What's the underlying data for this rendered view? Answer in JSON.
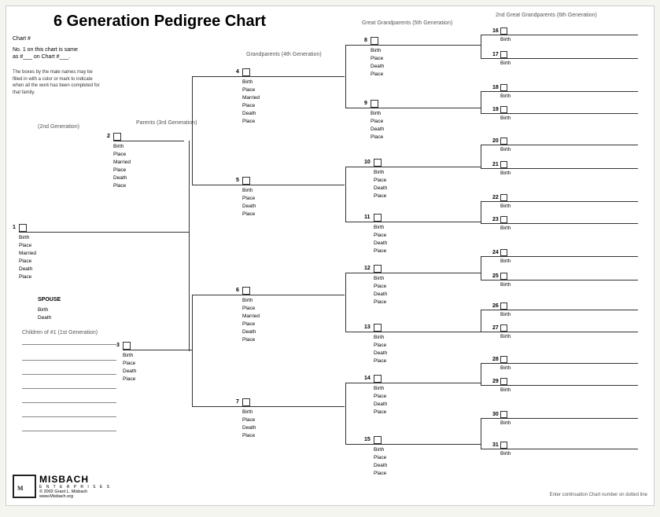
{
  "title": "6 Generation Pedigree Chart",
  "chartNum": "Chart #",
  "note1": "No. 1 on this chart is same",
  "note1b": "as #___ on Chart #___.",
  "note2": "The boxes by the male names may be filled in with a color or mark to indicate when all the work has been completed for that family.",
  "genLabels": {
    "gen2": "(2nd Generation)",
    "gen3": "Parents (3rd Generation)",
    "gen4": "Grandparents (4th Generation)",
    "gen5": "Great Grandparents (5th Generation)",
    "gen6": "2nd Great Grandparents (6th Generation)"
  },
  "fields": [
    "Birth",
    "Place",
    "Married",
    "Place",
    "Death",
    "Place"
  ],
  "fieldsShort": [
    "Birth",
    "Place",
    "Death",
    "Place"
  ],
  "fieldsBirth": [
    "Birth"
  ],
  "spouse": {
    "label": "SPOUSE",
    "fields": [
      "Birth",
      "Death"
    ]
  },
  "children": "Children of #1 (1st Generation)",
  "contLabel": "Enter continuation Chart number on dotted line",
  "logoText": "MISBACH",
  "logoSub": "E N T E R P R I S E S",
  "logoCopy": "© 2002 Grant L. Misbach",
  "logoUrl": "www.Misbach.org",
  "persons": [
    {
      "num": "1",
      "fields": [
        "Birth",
        "Place",
        "Married",
        "Place",
        "Death",
        "Place"
      ]
    },
    {
      "num": "2",
      "fields": [
        "Birth",
        "Place",
        "Married",
        "Place",
        "Death",
        "Place"
      ]
    },
    {
      "num": "3",
      "fields": [
        "Birth",
        "Place",
        "Death",
        "Place"
      ]
    },
    {
      "num": "4",
      "fields": [
        "Birth",
        "Place",
        "Married",
        "Place",
        "Death",
        "Place"
      ]
    },
    {
      "num": "5",
      "fields": [
        "Birth",
        "Place",
        "Death",
        "Place"
      ]
    },
    {
      "num": "6",
      "fields": [
        "Birth",
        "Place",
        "Married",
        "Place",
        "Death",
        "Place"
      ]
    },
    {
      "num": "7",
      "fields": [
        "Birth",
        "Place",
        "Death",
        "Place"
      ]
    },
    {
      "num": "8",
      "fields": [
        "Birth",
        "Place",
        "Death",
        "Place"
      ]
    },
    {
      "num": "9",
      "fields": [
        "Birth",
        "Place",
        "Death",
        "Place"
      ]
    },
    {
      "num": "10",
      "fields": [
        "Birth",
        "Place",
        "Death",
        "Place"
      ]
    },
    {
      "num": "11",
      "fields": [
        "Birth",
        "Place",
        "Death",
        "Place"
      ]
    },
    {
      "num": "12",
      "fields": [
        "Birth",
        "Place",
        "Death",
        "Place"
      ]
    },
    {
      "num": "13",
      "fields": [
        "Birth",
        "Place",
        "Death",
        "Place"
      ]
    },
    {
      "num": "14",
      "fields": [
        "Birth",
        "Place",
        "Death",
        "Place"
      ]
    },
    {
      "num": "15",
      "fields": [
        "Birth",
        "Place",
        "Death",
        "Place"
      ]
    },
    {
      "num": "16",
      "fields": [
        "Birth"
      ]
    },
    {
      "num": "17",
      "fields": [
        "Birth"
      ]
    },
    {
      "num": "18",
      "fields": [
        "Birth"
      ]
    },
    {
      "num": "19",
      "fields": [
        "Birth"
      ]
    },
    {
      "num": "20",
      "fields": [
        "Birth"
      ]
    },
    {
      "num": "21",
      "fields": [
        "Birth"
      ]
    },
    {
      "num": "22",
      "fields": [
        "Birth"
      ]
    },
    {
      "num": "23",
      "fields": [
        "Birth"
      ]
    },
    {
      "num": "24",
      "fields": [
        "Birth"
      ]
    },
    {
      "num": "25",
      "fields": [
        "Birth"
      ]
    },
    {
      "num": "26",
      "fields": [
        "Birth"
      ]
    },
    {
      "num": "27",
      "fields": [
        "Birth"
      ]
    },
    {
      "num": "28",
      "fields": [
        "Birth"
      ]
    },
    {
      "num": "29",
      "fields": [
        "Birth"
      ]
    },
    {
      "num": "30",
      "fields": [
        "Birth"
      ]
    },
    {
      "num": "31",
      "fields": [
        "Birth"
      ]
    }
  ]
}
